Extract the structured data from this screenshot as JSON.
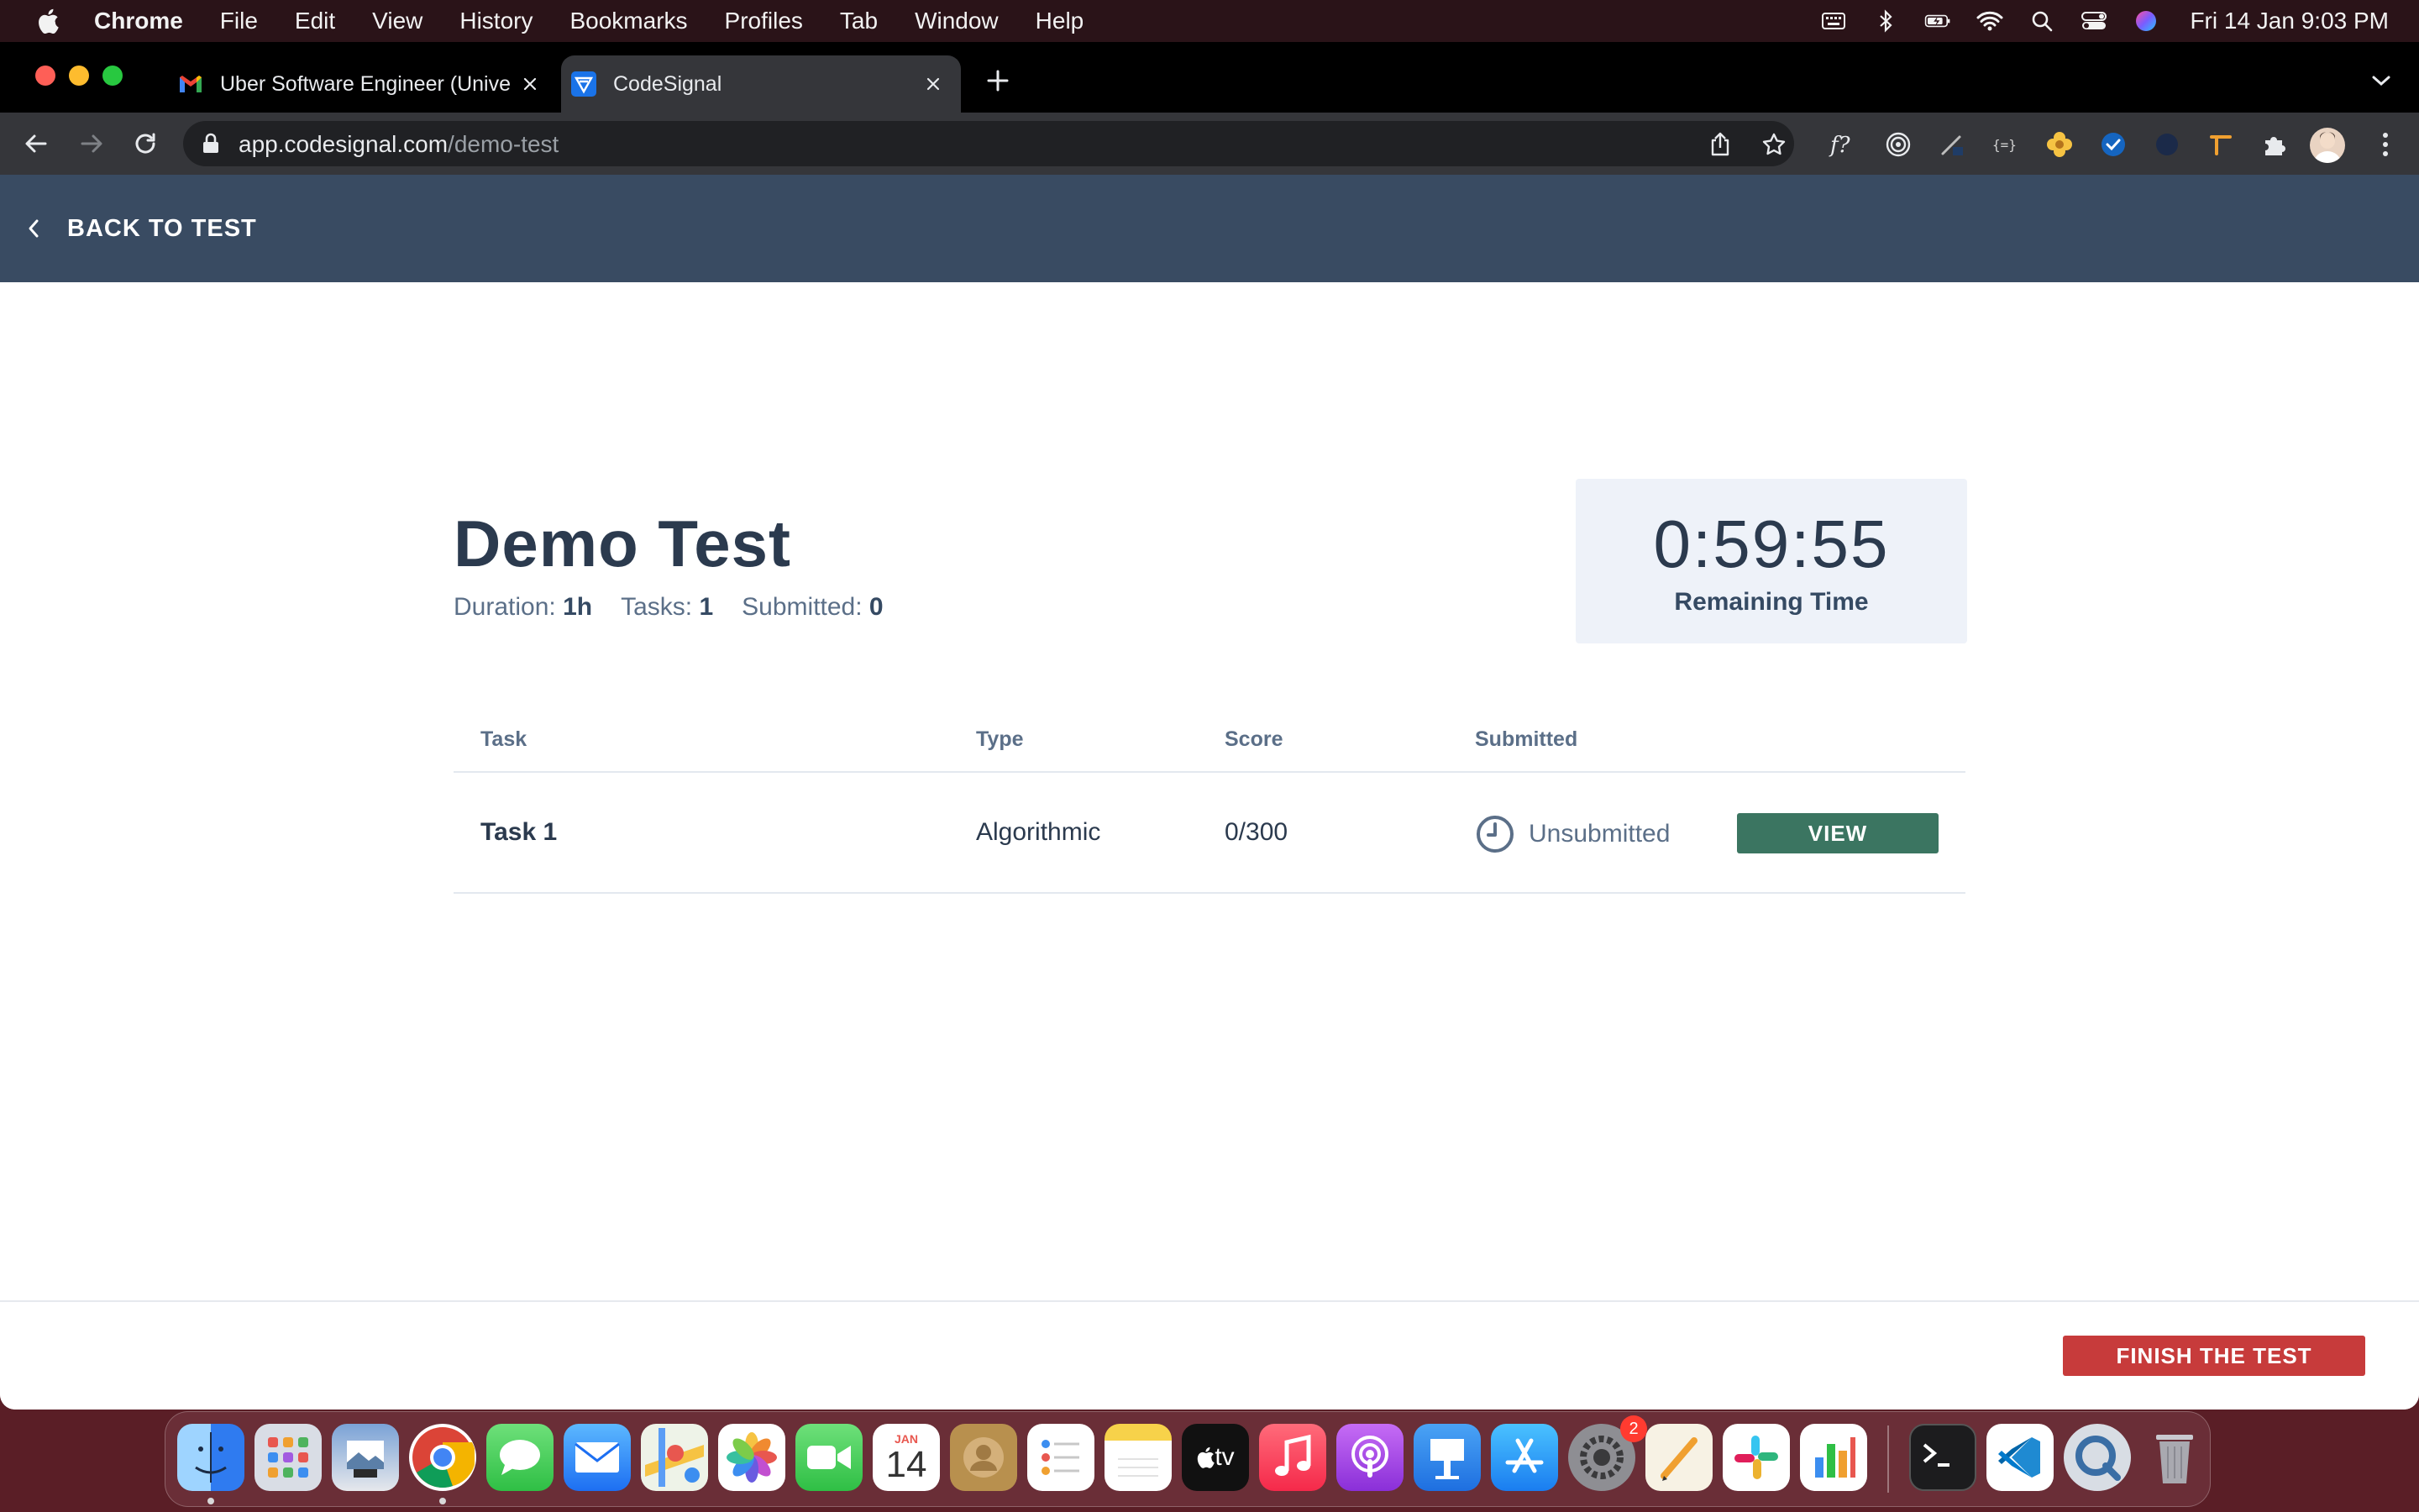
{
  "menubar": {
    "app_name": "Chrome",
    "items": [
      "File",
      "Edit",
      "View",
      "History",
      "Bookmarks",
      "Profiles",
      "Tab",
      "Window",
      "Help"
    ],
    "clock": "Fri 14 Jan  9:03 PM"
  },
  "browser": {
    "tabs": [
      {
        "title": "Uber Software Engineer (Unive",
        "favicon": "gmail-icon",
        "active": false
      },
      {
        "title": "CodeSignal",
        "favicon": "codesignal-icon",
        "active": true
      }
    ],
    "url_host": "app.codesignal.com",
    "url_path": "/demo-test"
  },
  "page": {
    "back_label": "BACK TO TEST",
    "title": "Demo Test",
    "meta": {
      "duration_label": "Duration:",
      "duration_value": "1h",
      "tasks_label": "Tasks:",
      "tasks_value": "1",
      "submitted_label": "Submitted:",
      "submitted_value": "0"
    },
    "timer": {
      "time": "0:59:55",
      "label": "Remaining Time"
    },
    "table": {
      "headers": {
        "task": "Task",
        "type": "Type",
        "score": "Score",
        "submitted": "Submitted"
      },
      "rows": [
        {
          "task": "Task 1",
          "type": "Algorithmic",
          "score": "0/300",
          "status": "Unsubmitted",
          "action": "VIEW"
        }
      ]
    },
    "finish_label": "FINISH THE TEST"
  },
  "dock": {
    "calendar_month": "JAN",
    "calendar_day": "14",
    "appletv_label": "tv",
    "settings_badge": "2"
  },
  "colors": {
    "header_bg": "#394b62",
    "view_button": "#3b7561",
    "finish_button": "#c73b3b",
    "timer_bg": "#eef2f9"
  }
}
